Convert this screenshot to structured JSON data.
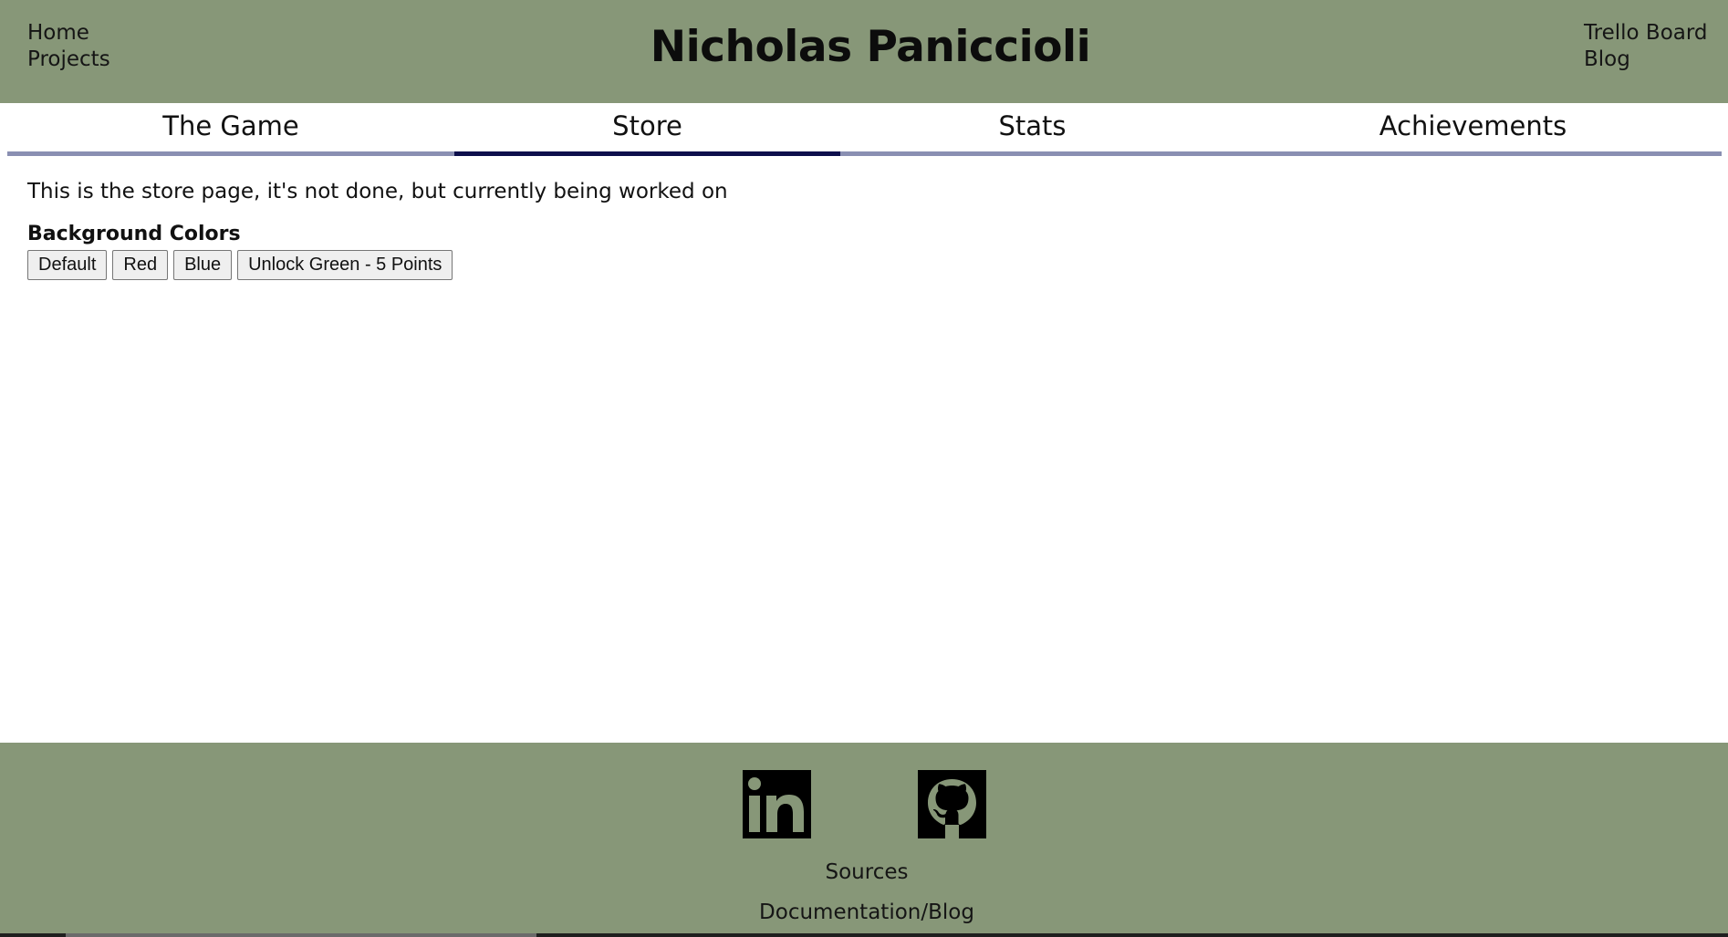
{
  "header": {
    "title": "Nicholas Paniccioli",
    "left_links": [
      "Home",
      "Projects"
    ],
    "right_links": [
      "Trello Board",
      "Blog"
    ],
    "background": "#879778"
  },
  "tabs": [
    {
      "label": "The Game",
      "active": false
    },
    {
      "label": "Store",
      "active": true
    },
    {
      "label": "Stats",
      "active": false
    },
    {
      "label": "Achievements",
      "active": false
    }
  ],
  "tab_colors": {
    "inactive": "#8a8fb2",
    "active": "#0d0f4c"
  },
  "main": {
    "intro": "This is the store page, it's not done, but currently being worked on",
    "section_heading": "Background Colors",
    "buttons": [
      "Default",
      "Red",
      "Blue",
      "Unlock Green - 5 Points"
    ]
  },
  "footer": {
    "icons": [
      "linkedin-icon",
      "github-icon"
    ],
    "links": [
      "Sources",
      "Documentation/Blog"
    ],
    "background": "#879778"
  }
}
